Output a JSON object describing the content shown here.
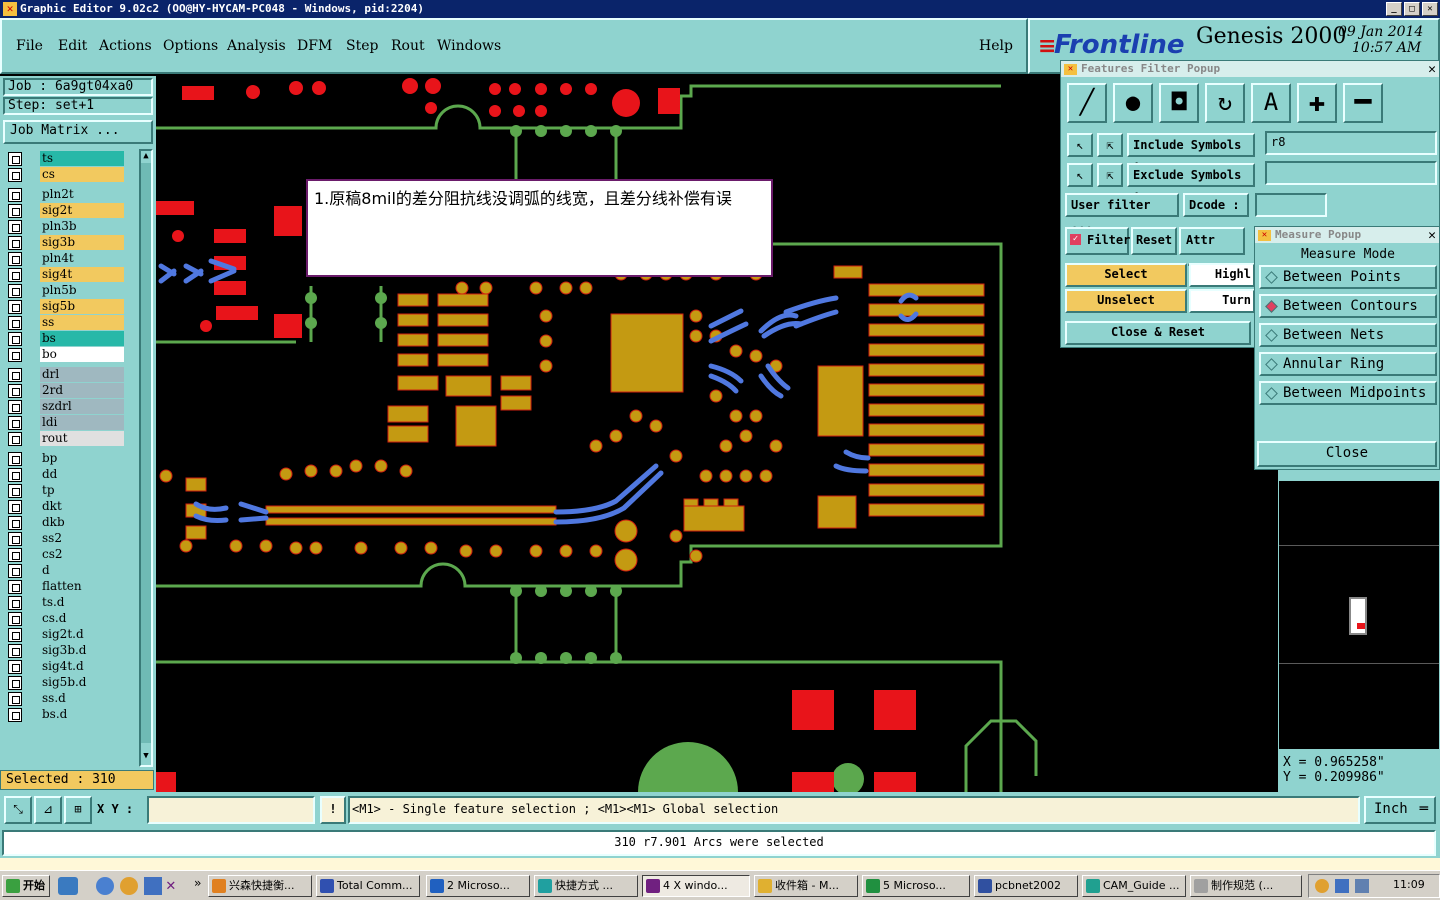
{
  "title_bar": "Graphic Editor 9.02c2  (OO@HY-HYCAM-PC048 - Windows, pid:2204)",
  "menu": [
    "File",
    "Edit",
    "Actions",
    "Options",
    "Analysis",
    "DFM",
    "Step",
    "Rout",
    "Windows"
  ],
  "help": "Help",
  "logo": {
    "brand": "Frontline",
    "product": "Genesis 2000",
    "date": "09 Jan 2014",
    "time": "10:57 AM"
  },
  "job": "Job : 6a9gt04xa0",
  "step": "Step: set+1",
  "job_matrix": "Job Matrix ...",
  "layers": [
    {
      "name": "ts",
      "color": "#27b8a8"
    },
    {
      "name": "cs",
      "color": "#f2c95f"
    },
    {
      "name": "pln2t",
      "color": "#8fd3cf"
    },
    {
      "name": "sig2t",
      "color": "#f2c95f"
    },
    {
      "name": "pln3b",
      "color": "#8fd3cf"
    },
    {
      "name": "sig3b",
      "color": "#f2c95f"
    },
    {
      "name": "pln4t",
      "color": "#8fd3cf"
    },
    {
      "name": "sig4t",
      "color": "#f2c95f"
    },
    {
      "name": "pln5b",
      "color": "#8fd3cf"
    },
    {
      "name": "sig5b",
      "color": "#f2c95f"
    },
    {
      "name": "ss",
      "color": "#f2c95f"
    },
    {
      "name": "bs",
      "color": "#27b8a8"
    },
    {
      "name": "bo",
      "color": "#ffffff"
    },
    {
      "name": "drl",
      "color": "#9fb8c0"
    },
    {
      "name": "2rd",
      "color": "#9fb8c0"
    },
    {
      "name": "szdrl",
      "color": "#9fb8c0"
    },
    {
      "name": "ldi",
      "color": "#9fb8c0"
    },
    {
      "name": "rout",
      "color": "#e0e0e0"
    },
    {
      "name": "bp",
      "color": "#8fd3cf"
    },
    {
      "name": "dd",
      "color": "#8fd3cf"
    },
    {
      "name": "tp",
      "color": "#8fd3cf"
    },
    {
      "name": "dkt",
      "color": "#8fd3cf"
    },
    {
      "name": "dkb",
      "color": "#8fd3cf"
    },
    {
      "name": "ss2",
      "color": "#8fd3cf"
    },
    {
      "name": "cs2",
      "color": "#8fd3cf"
    },
    {
      "name": "d",
      "color": "#8fd3cf"
    },
    {
      "name": "flatten",
      "color": "#8fd3cf"
    },
    {
      "name": "ts.d",
      "color": "#8fd3cf"
    },
    {
      "name": "cs.d",
      "color": "#8fd3cf"
    },
    {
      "name": "sig2t.d",
      "color": "#8fd3cf"
    },
    {
      "name": "sig3b.d",
      "color": "#8fd3cf"
    },
    {
      "name": "sig4t.d",
      "color": "#8fd3cf"
    },
    {
      "name": "sig5b.d",
      "color": "#8fd3cf"
    },
    {
      "name": "ss.d",
      "color": "#8fd3cf"
    },
    {
      "name": "bs.d",
      "color": "#8fd3cf"
    }
  ],
  "selected": "Selected : 310",
  "annotation": "1.原稿8mil的差分阻抗线没调弧的线宽，且差分线补偿有误",
  "features_filter": {
    "title": "Features Filter Popup",
    "include_label": "Include Symbols :",
    "include_value": "r8",
    "exclude_label": "Exclude Symbols :",
    "exclude_value": "",
    "user_filter": "User filter ...",
    "dcode": "Dcode :",
    "filter": "Filter",
    "reset": "Reset",
    "attr": "Attr ...",
    "select": "Select",
    "unselect": "Unselect",
    "highlight": "Highl",
    "turn": "Turn",
    "close_reset": "Close & Reset"
  },
  "measure": {
    "title": "Measure Popup",
    "mode": "Measure Mode",
    "items": [
      "Between Points",
      "Between Contours",
      "Between Nets",
      "Annular Ring",
      "Between Midpoints"
    ],
    "selected_index": 1,
    "close": "Close"
  },
  "coords": {
    "x": "X = 0.965258\"",
    "y": "Y = 0.209986\""
  },
  "xy_label": "X Y :",
  "hint": "<M1> - Single feature selection ; <M1><M1> Global selection",
  "units": "Inch",
  "message": "310 r7.901 Arcs were selected",
  "taskbar": {
    "start": "开始",
    "items": [
      "兴森快捷衡...",
      "Total Comm...",
      "2 Microso...",
      "快捷方式 ...",
      "4 X windo...",
      "收件箱 - M...",
      "5 Microso...",
      "pcbnet2002",
      "CAM_Guide ...",
      "制作规范 (..."
    ],
    "clock": "11:09"
  }
}
